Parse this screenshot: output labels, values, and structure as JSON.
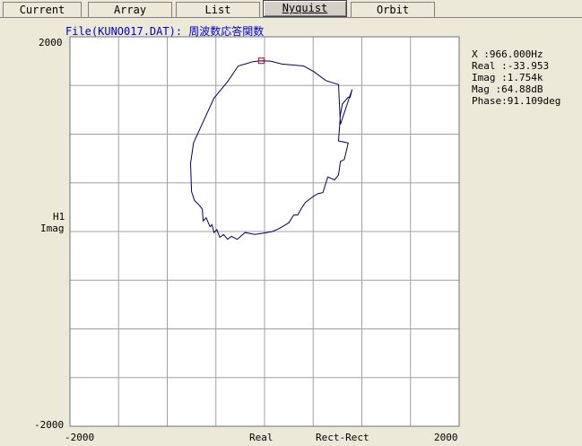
{
  "tabs": [
    {
      "label": "Current",
      "active": false
    },
    {
      "label": "Array",
      "active": false
    },
    {
      "label": "List",
      "active": false
    },
    {
      "label": "Nyquist",
      "active": true
    },
    {
      "label": "Orbit",
      "active": false
    }
  ],
  "file_title": "File(KUNO017.DAT): 周波数応答関数",
  "y_axis": {
    "top_label": "2000",
    "bottom_label": "-2000",
    "name_line1": "H1",
    "name_line2": "Imag"
  },
  "x_axis": {
    "left_label": "-2000",
    "right_label": "2000",
    "name": "Real",
    "mode": "Rect-Rect"
  },
  "readout": [
    "X    :966.000Hz",
    "Real :-33.953",
    "Imag :1.754k",
    "Mag  :64.88dB",
    "Phase:91.109deg"
  ],
  "colors": {
    "curve": "#000060",
    "cursor": "#c00000",
    "grid": "#a0a0a0",
    "title": "#0000c8"
  },
  "chart_data": {
    "type": "scatter",
    "title": "File(KUNO017.DAT): 周波数応答関数",
    "xlabel": "Real",
    "ylabel": "H1 Imag",
    "xlim": [
      -2000,
      2000
    ],
    "ylim": [
      -2000,
      2000
    ],
    "grid": true,
    "series": [
      {
        "values": [
          [
            -34,
            1754
          ],
          [
            -120,
            1745
          ],
          [
            -200,
            1720
          ],
          [
            -270,
            1700
          ],
          [
            -380,
            1540
          ],
          [
            -520,
            1370
          ],
          [
            -620,
            1150
          ],
          [
            -730,
            910
          ],
          [
            -760,
            700
          ],
          [
            -750,
            410
          ],
          [
            -720,
            320
          ],
          [
            -680,
            280
          ],
          [
            -640,
            230
          ],
          [
            -630,
            110
          ],
          [
            -600,
            140
          ],
          [
            -560,
            50
          ],
          [
            -540,
            70
          ],
          [
            -520,
            -10
          ],
          [
            -490,
            20
          ],
          [
            -460,
            -60
          ],
          [
            -420,
            -30
          ],
          [
            -380,
            -80
          ],
          [
            -340,
            -50
          ],
          [
            -280,
            -80
          ],
          [
            -200,
            -10
          ],
          [
            -100,
            -30
          ],
          [
            0,
            -15
          ],
          [
            80,
            0
          ],
          [
            150,
            30
          ],
          [
            250,
            90
          ],
          [
            300,
            170
          ],
          [
            340,
            170
          ],
          [
            380,
            240
          ],
          [
            420,
            300
          ],
          [
            500,
            360
          ],
          [
            550,
            390
          ],
          [
            600,
            400
          ],
          [
            650,
            560
          ],
          [
            720,
            530
          ],
          [
            760,
            580
          ],
          [
            780,
            720
          ],
          [
            820,
            740
          ],
          [
            860,
            910
          ],
          [
            760,
            930
          ],
          [
            780,
            1200
          ],
          [
            800,
            1310
          ],
          [
            860,
            1380
          ],
          [
            880,
            1380
          ],
          [
            900,
            1460
          ],
          [
            780,
            1100
          ],
          [
            760,
            1510
          ],
          [
            630,
            1550
          ],
          [
            510,
            1640
          ],
          [
            400,
            1700
          ],
          [
            180,
            1720
          ],
          [
            60,
            1750
          ],
          [
            -34,
            1754
          ]
        ]
      }
    ],
    "cursor": {
      "x": -33.953,
      "y": 1754,
      "frequency": "966.000Hz"
    }
  }
}
